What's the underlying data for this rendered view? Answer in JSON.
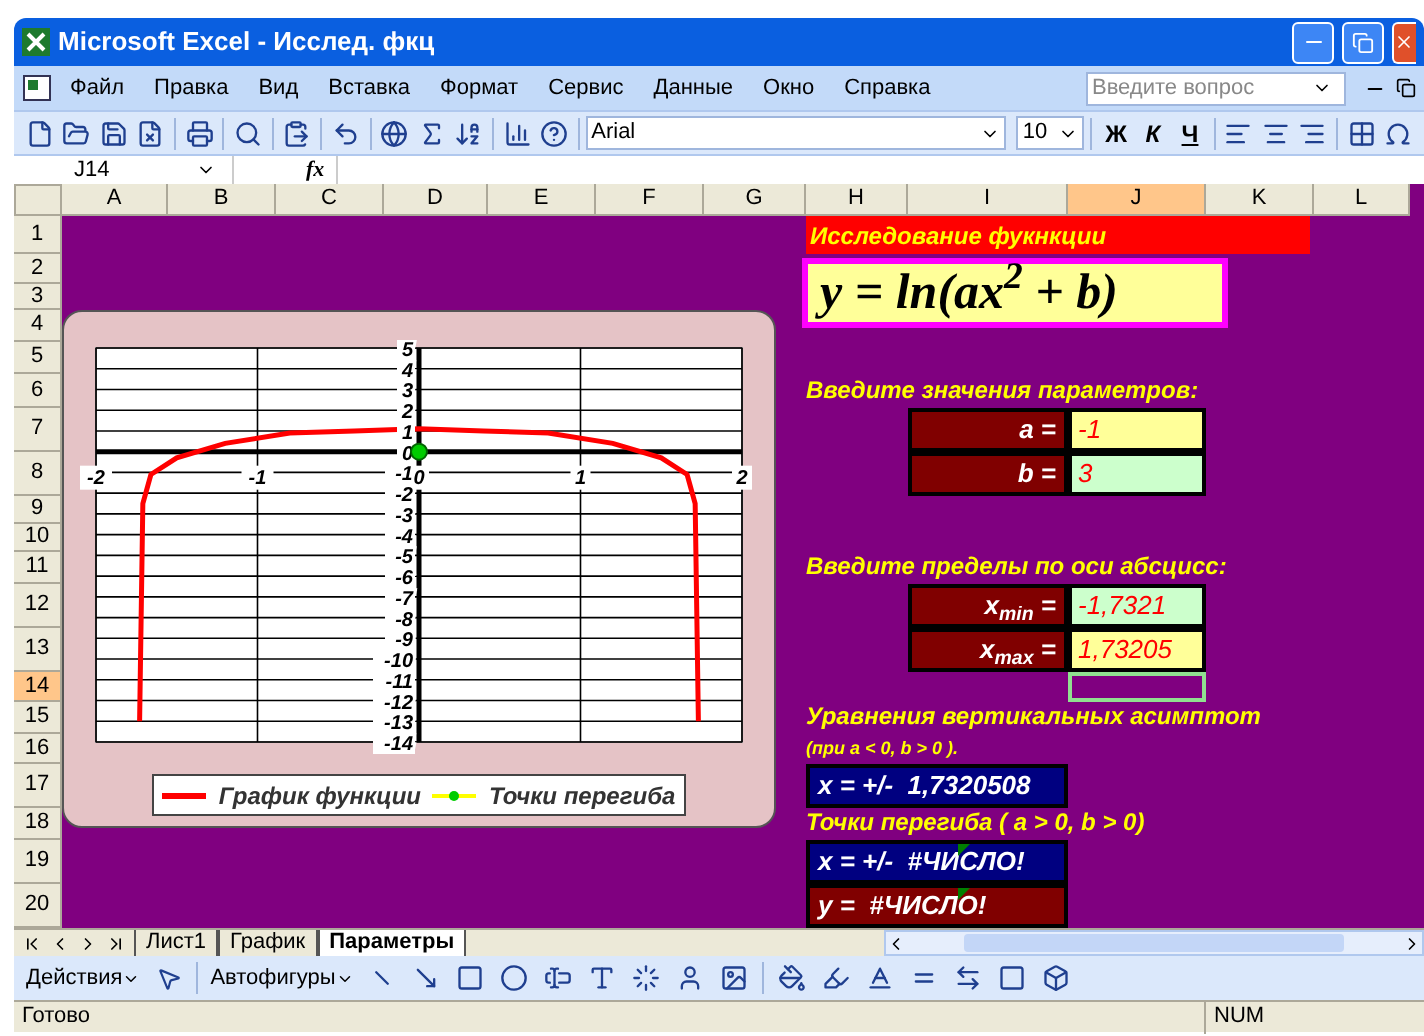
{
  "window": {
    "title": "Microsoft Excel - Исслед. фкц"
  },
  "menu_bar": {
    "items": [
      "Файл",
      "Правка",
      "Вид",
      "Вставка",
      "Формат",
      "Сервис",
      "Данные",
      "Окно",
      "Справка"
    ],
    "help_placeholder": "Введите вопрос"
  },
  "toolbar": {
    "font": "Arial",
    "font_size": "10",
    "bold": "Ж",
    "italic": "К",
    "underline": "Ч"
  },
  "formula_bar": {
    "cell_ref": "J14",
    "fx": "fx"
  },
  "columns": [
    {
      "label": "A",
      "selected": false
    },
    {
      "label": "B",
      "selected": false
    },
    {
      "label": "C",
      "selected": false
    },
    {
      "label": "D",
      "selected": false
    },
    {
      "label": "E",
      "selected": false
    },
    {
      "label": "F",
      "selected": false
    },
    {
      "label": "G",
      "selected": false
    },
    {
      "label": "H",
      "selected": false
    },
    {
      "label": "I",
      "selected": false
    },
    {
      "label": "J",
      "selected": true
    },
    {
      "label": "K",
      "selected": false
    },
    {
      "label": "L",
      "selected": false
    }
  ],
  "rows": [
    {
      "label": "1",
      "selected": false
    },
    {
      "label": "2",
      "selected": false
    },
    {
      "label": "3",
      "selected": false
    },
    {
      "label": "4",
      "selected": false
    },
    {
      "label": "5",
      "selected": false
    },
    {
      "label": "6",
      "selected": false
    },
    {
      "label": "7",
      "selected": false
    },
    {
      "label": "8",
      "selected": false
    },
    {
      "label": "9",
      "selected": false
    },
    {
      "label": "10",
      "selected": false
    },
    {
      "label": "11",
      "selected": false
    },
    {
      "label": "12",
      "selected": false
    },
    {
      "label": "13",
      "selected": false
    },
    {
      "label": "14",
      "selected": true
    },
    {
      "label": "15",
      "selected": false
    },
    {
      "label": "16",
      "selected": false
    },
    {
      "label": "17",
      "selected": false
    },
    {
      "label": "18",
      "selected": false
    },
    {
      "label": "19",
      "selected": false
    },
    {
      "label": "20",
      "selected": false
    }
  ],
  "chart": {
    "chart_data": {
      "type": "line",
      "x": [
        -1.73,
        -1.71,
        -1.66,
        -1.5,
        -1.2,
        -0.8,
        -0.4,
        0,
        0.4,
        0.8,
        1.2,
        1.5,
        1.66,
        1.71,
        1.73
      ],
      "series": [
        {
          "name": "График функции",
          "color": "#ff0000",
          "values": [
            -13,
            -2.5,
            -1.1,
            -0.3,
            0.4,
            0.9,
            1,
            1.1,
            1,
            0.9,
            0.4,
            -0.3,
            -1.1,
            -2.5,
            -13
          ]
        },
        {
          "name": "Точки перегиба",
          "color": "#00cc00",
          "marker": "circle",
          "values": [
            null,
            null,
            null,
            null,
            null,
            null,
            null,
            0,
            null,
            null,
            null,
            null,
            null,
            null,
            null
          ]
        }
      ],
      "grid": true,
      "xlim": [
        -2,
        2
      ],
      "ylim": [
        -14,
        5
      ],
      "xticks": [
        -2,
        -1,
        0,
        1,
        2
      ],
      "yticks": [
        -14,
        -13,
        -12,
        -11,
        -10,
        -9,
        -8,
        -7,
        -6,
        -5,
        -4,
        -3,
        -2,
        -1,
        0,
        1,
        2,
        3,
        4,
        5
      ]
    }
  },
  "panel": [
    {
      "kind": "title",
      "text": "Исследование фукнкции"
    },
    {
      "kind": "formula",
      "text": "y = ln(ax$^{2}$ + b)"
    },
    {
      "kind": "heading",
      "text": "Введите значения параметров:"
    },
    {
      "kind": "param",
      "label": "a =",
      "value": "-1",
      "color": "#ffff99"
    },
    {
      "kind": "param",
      "label": "b =",
      "value": "3",
      "color": "#ccffcc"
    },
    {
      "kind": "heading",
      "text": "Введите пределы по оси абсцисс:"
    },
    {
      "kind": "param",
      "label": "x$_{min}$ =",
      "value": "-1,7321",
      "color": "#ccffcc"
    },
    {
      "kind": "param",
      "label": "x$_{max}$ =",
      "value": "1,73205",
      "color": "#ffff99"
    },
    {
      "kind": "heading",
      "text": "Уравнения вертикальных асимптот"
    },
    {
      "kind": "note",
      "text": "(при a < 0, b > 0 )."
    },
    {
      "kind": "result",
      "text": "x = +/-  1,7320508",
      "color": "#000080",
      "error_flag": false
    },
    {
      "kind": "heading",
      "text": "Точки перегиба ( a > 0, b > 0)"
    },
    {
      "kind": "result",
      "text": "x = +/-  #ЧИСЛО!",
      "color": "#000080",
      "error_flag": true
    },
    {
      "kind": "result",
      "text": "y =  #ЧИСЛО!",
      "color": "#800000",
      "error_flag": true
    }
  ],
  "sheet_tabs": [
    {
      "label": "Лист1",
      "selected": false
    },
    {
      "label": "График",
      "selected": false
    },
    {
      "label": "Параметры",
      "selected": true
    }
  ],
  "drawing_toolbar": {
    "actions": "Действия",
    "autoshapes": "Автофигуры"
  },
  "status_bar": {
    "text": "Готово",
    "num": "NUM"
  }
}
